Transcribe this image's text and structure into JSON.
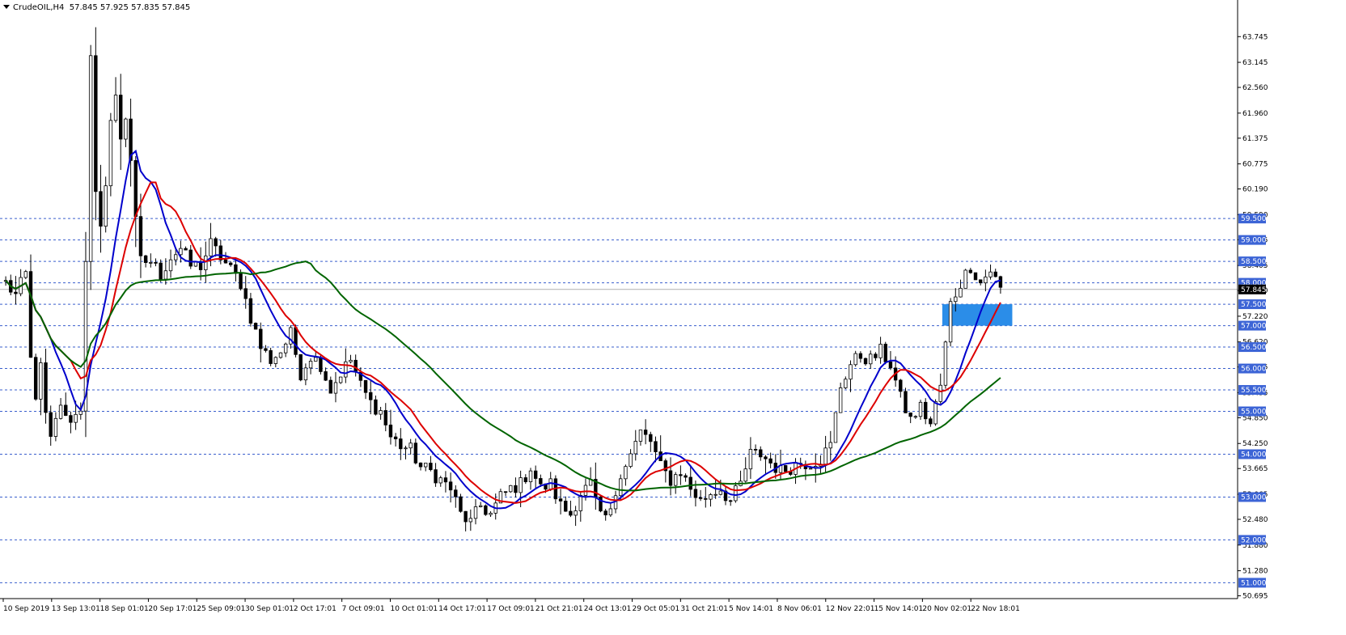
{
  "header": {
    "symbol": "CrudeOIL,H4",
    "ohlc": "57.845 57.925 57.835 57.845"
  },
  "colors": {
    "background": "#ffffff",
    "candle": "#000000",
    "ma_fast": "#0000cc",
    "ma_mid": "#dd0000",
    "ma_slow": "#006400",
    "level_line": "#3a5fcd",
    "level_label_bg": "#3c64d6",
    "current_price_bg": "#000000",
    "zone": "#2b8de8"
  },
  "chart_data": {
    "type": "candlestick",
    "instrument": "CrudeOIL",
    "timeframe": "H4",
    "y_ticks": [
      "63.745",
      "63.145",
      "62.560",
      "61.960",
      "61.375",
      "60.775",
      "60.190",
      "59.590",
      "59.005",
      "58.405",
      "57.820",
      "57.220",
      "56.620",
      "56.035",
      "55.435",
      "54.850",
      "54.250",
      "53.665",
      "53.065",
      "52.480",
      "51.880",
      "51.280",
      "50.695"
    ],
    "ylim": [
      50.63,
      64.26
    ],
    "x_labels": [
      "10 Sep 2019",
      "13 Sep 13:01",
      "18 Sep 01:01",
      "20 Sep 17:01",
      "25 Sep 09:01",
      "30 Sep 01:01",
      "2 Oct 17:01",
      "7 Oct 09:01",
      "10 Oct 01:01",
      "14 Oct 17:01",
      "17 Oct 09:01",
      "21 Oct 21:01",
      "24 Oct 13:01",
      "29 Oct 05:01",
      "31 Oct 21:01",
      "5 Nov 14:01",
      "8 Nov 06:01",
      "12 Nov 22:01",
      "15 Nov 14:01",
      "20 Nov 02:01",
      "22 Nov 18:01"
    ],
    "horizontal_levels": [
      "59.500",
      "59.000",
      "58.500",
      "58.000",
      "57.500",
      "57.000",
      "56.500",
      "56.000",
      "55.500",
      "55.000",
      "54.000",
      "53.000",
      "52.000",
      "51.000"
    ],
    "current_price": "57.845",
    "zone": {
      "y_top": 57.5,
      "y_bottom": 57.0,
      "x_start_candle": 188,
      "x_end_candle": 202
    },
    "num_candles": 200,
    "price_path": [
      [
        0,
        58.0
      ],
      [
        2,
        57.7
      ],
      [
        4,
        58.2
      ],
      [
        5,
        56.2
      ],
      [
        6,
        55.4
      ],
      [
        7,
        56.0
      ],
      [
        8,
        54.9
      ],
      [
        9,
        54.3
      ],
      [
        11,
        55.2
      ],
      [
        12,
        54.8
      ],
      [
        14,
        54.9
      ],
      [
        15,
        55.1
      ],
      [
        16,
        58.6
      ],
      [
        17,
        63.2
      ],
      [
        18,
        60.0
      ],
      [
        19,
        59.2
      ],
      [
        20,
        60.4
      ],
      [
        21,
        61.8
      ],
      [
        22,
        62.3
      ],
      [
        23,
        61.4
      ],
      [
        24,
        61.9
      ],
      [
        25,
        60.9
      ],
      [
        26,
        59.4
      ],
      [
        27,
        58.5
      ],
      [
        29,
        58.5
      ],
      [
        31,
        58.2
      ],
      [
        33,
        58.6
      ],
      [
        35,
        58.8
      ],
      [
        37,
        58.4
      ],
      [
        39,
        58.4
      ],
      [
        41,
        58.9
      ],
      [
        43,
        58.6
      ],
      [
        45,
        58.3
      ],
      [
        47,
        58.0
      ],
      [
        49,
        57.2
      ],
      [
        51,
        56.5
      ],
      [
        53,
        56.2
      ],
      [
        55,
        56.4
      ],
      [
        57,
        56.8
      ],
      [
        59,
        55.9
      ],
      [
        61,
        56.3
      ],
      [
        63,
        56.1
      ],
      [
        65,
        55.5
      ],
      [
        67,
        55.9
      ],
      [
        69,
        56.2
      ],
      [
        71,
        55.6
      ],
      [
        73,
        55.2
      ],
      [
        75,
        55.0
      ],
      [
        77,
        54.4
      ],
      [
        79,
        54.2
      ],
      [
        81,
        54.1
      ],
      [
        83,
        53.7
      ],
      [
        85,
        53.6
      ],
      [
        87,
        53.4
      ],
      [
        89,
        53.2
      ],
      [
        91,
        52.6
      ],
      [
        93,
        52.4
      ],
      [
        95,
        52.8
      ],
      [
        97,
        52.6
      ],
      [
        99,
        53.0
      ],
      [
        101,
        53.2
      ],
      [
        103,
        53.3
      ],
      [
        105,
        53.7
      ],
      [
        107,
        53.2
      ],
      [
        109,
        53.3
      ],
      [
        111,
        52.8
      ],
      [
        113,
        52.6
      ],
      [
        115,
        53.1
      ],
      [
        117,
        53.3
      ],
      [
        119,
        52.5
      ],
      [
        121,
        52.6
      ],
      [
        123,
        53.6
      ],
      [
        125,
        54.0
      ],
      [
        127,
        54.5
      ],
      [
        129,
        54.3
      ],
      [
        131,
        53.7
      ],
      [
        133,
        53.4
      ],
      [
        135,
        53.6
      ],
      [
        137,
        53.2
      ],
      [
        139,
        52.9
      ],
      [
        141,
        53.1
      ],
      [
        143,
        53.2
      ],
      [
        145,
        52.9
      ],
      [
        147,
        53.3
      ],
      [
        149,
        54.0
      ],
      [
        151,
        54.0
      ],
      [
        153,
        53.8
      ],
      [
        155,
        53.6
      ],
      [
        157,
        53.7
      ],
      [
        159,
        53.8
      ],
      [
        161,
        53.8
      ],
      [
        163,
        53.9
      ],
      [
        165,
        54.2
      ],
      [
        167,
        55.6
      ],
      [
        169,
        56.1
      ],
      [
        171,
        56.3
      ],
      [
        173,
        56.2
      ],
      [
        175,
        56.4
      ],
      [
        177,
        56.1
      ],
      [
        179,
        55.3
      ],
      [
        181,
        54.8
      ],
      [
        183,
        55.1
      ],
      [
        185,
        54.7
      ],
      [
        187,
        55.6
      ],
      [
        189,
        57.5
      ],
      [
        191,
        58.0
      ],
      [
        193,
        58.4
      ],
      [
        195,
        58.0
      ],
      [
        197,
        58.3
      ],
      [
        199,
        57.85
      ]
    ]
  }
}
